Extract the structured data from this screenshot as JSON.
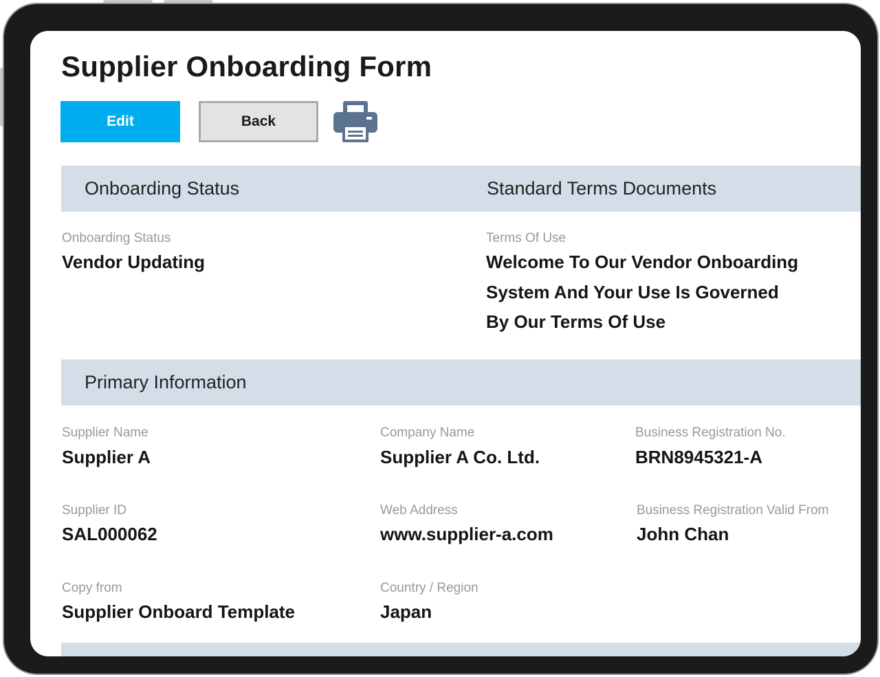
{
  "page": {
    "title": "Supplier Onboarding Form"
  },
  "toolbar": {
    "edit_label": "Edit",
    "back_label": "Back",
    "print_icon": "printer-icon",
    "edit_color": "#00aeef",
    "print_color": "#5c7390"
  },
  "sections": {
    "onboarding_status": {
      "title": "Onboarding Status",
      "field_label": "Onboarding Status",
      "field_value": "Vendor Updating"
    },
    "terms": {
      "title": "Standard Terms Documents",
      "field_label": "Terms Of Use",
      "lines": [
        "Welcome To Our Vendor Onboarding",
        "System And Your Use Is Governed",
        "By Our Terms Of Use"
      ]
    },
    "primary": {
      "title": "Primary Information",
      "fields": [
        {
          "label": "Supplier Name",
          "value": "Supplier A"
        },
        {
          "label": "Company Name",
          "value": "Supplier A Co. Ltd."
        },
        {
          "label": "Business Registration No.",
          "value": "BRN8945321-A"
        },
        {
          "label": "Supplier ID",
          "value": "SAL000062"
        },
        {
          "label": "Web Address",
          "value": "www.supplier-a.com"
        },
        {
          "label": "Business Registration Valid From",
          "value": "John Chan"
        },
        {
          "label": "Copy from",
          "value": "Supplier Onboard Template"
        },
        {
          "label": "Country / Region",
          "value": "Japan"
        }
      ]
    }
  },
  "colors": {
    "section_header_bg": "#d5dde8",
    "label_gray": "#999999"
  }
}
